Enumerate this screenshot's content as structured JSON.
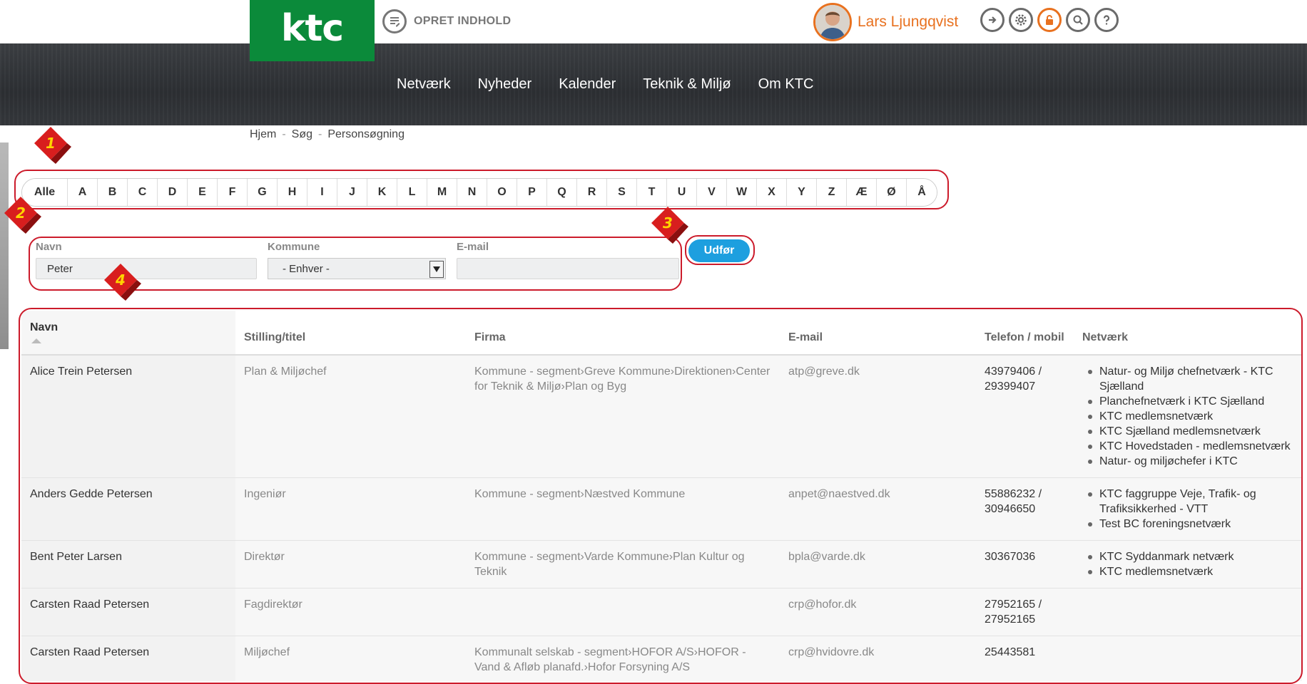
{
  "header": {
    "logo_text": "ktc",
    "create_label": "OPRET INDHOLD",
    "user_name": "Lars  Ljungqvist"
  },
  "nav": {
    "items": [
      "Netværk",
      "Nyheder",
      "Kalender",
      "Teknik & Miljø",
      "Om KTC"
    ]
  },
  "breadcrumb": [
    "Hjem",
    "Søg",
    "Personsøgning"
  ],
  "annotations": [
    "1",
    "2",
    "3",
    "4"
  ],
  "alphabet": {
    "all_label": "Alle",
    "letters": [
      "A",
      "B",
      "C",
      "D",
      "E",
      "F",
      "G",
      "H",
      "I",
      "J",
      "K",
      "L",
      "M",
      "N",
      "O",
      "P",
      "Q",
      "R",
      "S",
      "T",
      "U",
      "V",
      "W",
      "X",
      "Y",
      "Z",
      "Æ",
      "Ø",
      "Å"
    ]
  },
  "filters": {
    "name_label": "Navn",
    "name_value": "Peter",
    "kommune_label": "Kommune",
    "kommune_value": "- Enhver -",
    "email_label": "E-mail",
    "email_value": "",
    "submit_label": "Udfør"
  },
  "table": {
    "columns": [
      "Navn",
      "Stilling/titel",
      "Firma",
      "E-mail",
      "Telefon / mobil",
      "Netværk"
    ],
    "rows": [
      {
        "name": "Alice Trein Petersen",
        "title": "Plan & Miljøchef",
        "company": "Kommune - segment›Greve Kommune›Direktionen›Center for Teknik & Miljø›Plan og Byg",
        "email": "atp@greve.dk",
        "phone": "43979406 / 29399407",
        "networks": [
          "Natur- og Miljø chefnetværk - KTC Sjælland",
          "Planchefnetværk i KTC Sjælland",
          "KTC medlemsnetværk",
          "KTC Sjælland medlemsnetværk",
          "KTC Hovedstaden - medlemsnetværk",
          "Natur- og miljøchefer i KTC"
        ]
      },
      {
        "name": "Anders Gedde Petersen",
        "title": "Ingeniør",
        "company": "Kommune - segment›Næstved Kommune",
        "email": "anpet@naestved.dk",
        "phone": "55886232 / 30946650",
        "networks": [
          "KTC faggruppe Veje, Trafik- og Trafiksikkerhed - VTT",
          "Test BC foreningsnetværk"
        ]
      },
      {
        "name": "Bent Peter Larsen",
        "title": "Direktør",
        "company": "Kommune - segment›Varde Kommune›Plan Kultur og Teknik",
        "email": "bpla@varde.dk",
        "phone": "30367036",
        "networks": [
          "KTC Syddanmark netværk",
          "KTC medlemsnetværk"
        ]
      },
      {
        "name": "Carsten Raad Petersen",
        "title": "Fagdirektør",
        "company": "",
        "email": "crp@hofor.dk",
        "phone": "27952165 / 27952165",
        "networks": []
      },
      {
        "name": "Carsten Raad Petersen",
        "title": "Miljøchef",
        "company": "Kommunalt selskab - segment›HOFOR A/S›HOFOR - Vand & Afløb planafd.›Hofor Forsyning A/S",
        "email": "crp@hvidovre.dk",
        "phone": "25443581",
        "networks": []
      }
    ]
  },
  "colors": {
    "logo_green": "#0b8a3a",
    "accent_orange": "#e8711f",
    "button_blue": "#1d9fdf",
    "annotation_red": "#cc1b2b",
    "annotation_number": "#ffd400"
  }
}
